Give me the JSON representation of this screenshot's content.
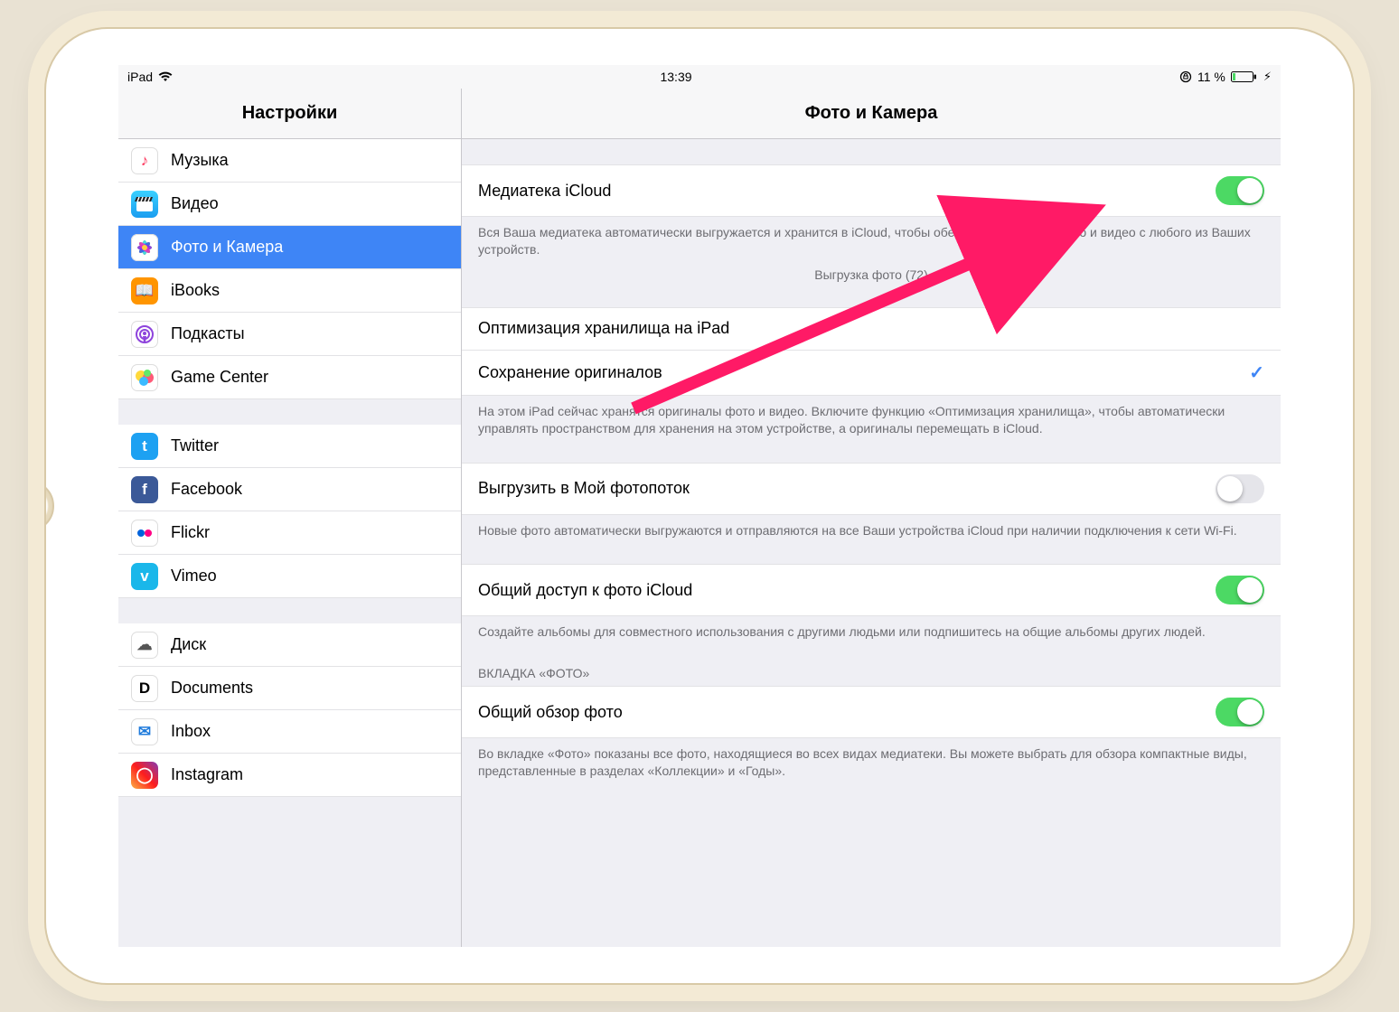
{
  "statusbar": {
    "device": "iPad",
    "time": "13:39",
    "battery_text": "11 %"
  },
  "sidebar": {
    "title": "Настройки",
    "groups": [
      {
        "items": [
          {
            "id": "music",
            "label": "Музыка",
            "icon_bg": "#ffffff",
            "icon_glyph": "♪",
            "icon_color": "#fc3259"
          },
          {
            "id": "video",
            "label": "Видео",
            "icon_bg": "linear-gradient(#3bd1ff,#1a9df0)",
            "icon_svg": "clapper"
          },
          {
            "id": "photos",
            "label": "Фото и Камера",
            "icon_bg": "#ffffff",
            "icon_svg": "flower",
            "selected": true
          },
          {
            "id": "ibooks",
            "label": "iBooks",
            "icon_bg": "#ff9500",
            "icon_glyph": "📖",
            "icon_color": "#fff"
          },
          {
            "id": "podcasts",
            "label": "Подкасты",
            "icon_bg": "#ffffff",
            "icon_svg": "podcast"
          },
          {
            "id": "gamecenter",
            "label": "Game Center",
            "icon_bg": "#ffffff",
            "icon_svg": "gc"
          }
        ]
      },
      {
        "items": [
          {
            "id": "twitter",
            "label": "Twitter",
            "icon_bg": "#1da1f2",
            "icon_glyph": "t",
            "icon_color": "#fff"
          },
          {
            "id": "facebook",
            "label": "Facebook",
            "icon_bg": "#3b5998",
            "icon_glyph": "f",
            "icon_color": "#fff"
          },
          {
            "id": "flickr",
            "label": "Flickr",
            "icon_bg": "#ffffff",
            "icon_svg": "flickr"
          },
          {
            "id": "vimeo",
            "label": "Vimeo",
            "icon_bg": "#1ab7ea",
            "icon_glyph": "v",
            "icon_color": "#fff"
          }
        ]
      },
      {
        "items": [
          {
            "id": "disk",
            "label": "Диск",
            "icon_bg": "#ffffff",
            "icon_glyph": "☁︎",
            "icon_color": "#555"
          },
          {
            "id": "documents",
            "label": "Documents",
            "icon_bg": "#ffffff",
            "icon_glyph": "D",
            "icon_color": "#000"
          },
          {
            "id": "inbox",
            "label": "Inbox",
            "icon_bg": "#ffffff",
            "icon_glyph": "✉︎",
            "icon_color": "#1f7bdc"
          },
          {
            "id": "instagram",
            "label": "Instagram",
            "icon_bg": "linear-gradient(45deg,#fcb045,#fd1d1d,#833ab4)",
            "icon_glyph": "◯",
            "icon_color": "#fff"
          }
        ]
      }
    ]
  },
  "detail": {
    "title": "Фото и Камера",
    "sections": [
      {
        "rows": [
          {
            "id": "icloud-library",
            "label": "Медиатека iCloud",
            "type": "toggle",
            "on": true
          }
        ],
        "footer": "Вся Ваша медиатека автоматически выгружается и хранится в iCloud, чтобы обеспечить доступ к фото и видео с любого из Ваших устройств.",
        "center": "Выгрузка фото (72)"
      },
      {
        "rows": [
          {
            "id": "optimize",
            "label": "Оптимизация хранилища на iPad",
            "type": "radio",
            "checked": false
          },
          {
            "id": "keep-orig",
            "label": "Сохранение оригиналов",
            "type": "radio",
            "checked": true
          }
        ],
        "footer": "На этом iPad сейчас хранятся оригиналы фото и видео. Включите функцию «Оптимизация хранилища», чтобы автоматически управлять пространством для хранения на этом устройстве, а оригиналы перемещать в iCloud."
      },
      {
        "rows": [
          {
            "id": "my-stream",
            "label": "Выгрузить в Мой фотопоток",
            "type": "toggle",
            "on": false
          }
        ],
        "footer": "Новые фото автоматически выгружаются и отправляются на все Ваши устройства iCloud при наличии подключения к сети Wi-Fi."
      },
      {
        "rows": [
          {
            "id": "shared",
            "label": "Общий доступ к фото iCloud",
            "type": "toggle",
            "on": true
          }
        ],
        "footer": "Создайте альбомы для совместного использования с другими людьми или подпишитесь на общие альбомы других людей."
      },
      {
        "header": "ВКЛАДКА «ФОТО»",
        "rows": [
          {
            "id": "summarize",
            "label": "Общий обзор фото",
            "type": "toggle",
            "on": true
          }
        ],
        "footer": "Во вкладке «Фото» показаны все фото, находящиеся во всех видах медиатеки. Вы можете выбрать для обзора компактные виды, представленные в разделах «Коллекции» и «Годы»."
      }
    ]
  }
}
